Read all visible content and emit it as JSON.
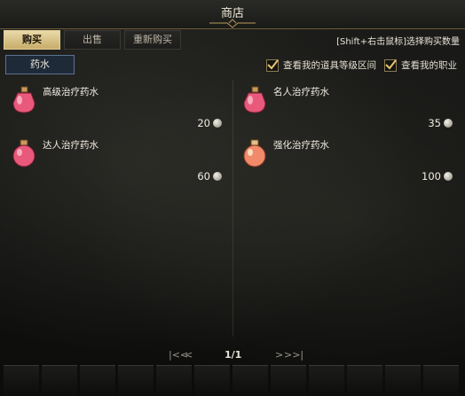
{
  "window": {
    "title": "商店"
  },
  "tabs": [
    {
      "label": "购买",
      "active": true
    },
    {
      "label": "出售",
      "active": false
    },
    {
      "label": "重新购买",
      "active": false
    }
  ],
  "hint": "[Shift+右击鼠标]选择购买数量",
  "category": "药水",
  "filters": [
    {
      "label": "查看我的道具等级区间",
      "checked": true
    },
    {
      "label": "查看我的职业",
      "checked": true
    }
  ],
  "items": [
    {
      "name": "高级治疗药水",
      "price": "20",
      "icon": "potion-pink-flask-icon"
    },
    {
      "name": "名人治疗药水",
      "price": "35",
      "icon": "potion-pink-flask-icon"
    },
    {
      "name": "达人治疗药水",
      "price": "60",
      "icon": "potion-pink-round-icon"
    },
    {
      "name": "强化治疗药水",
      "price": "100",
      "icon": "potion-orange-round-icon"
    }
  ],
  "pagination": {
    "first": "|<<",
    "prev": "<",
    "page": "1/1",
    "next": ">",
    "last": ">>|"
  },
  "colors": {
    "accent_gold": "#c7ac6a",
    "category_blue": "#1e2a38",
    "potion_pink": "#e8597b"
  }
}
